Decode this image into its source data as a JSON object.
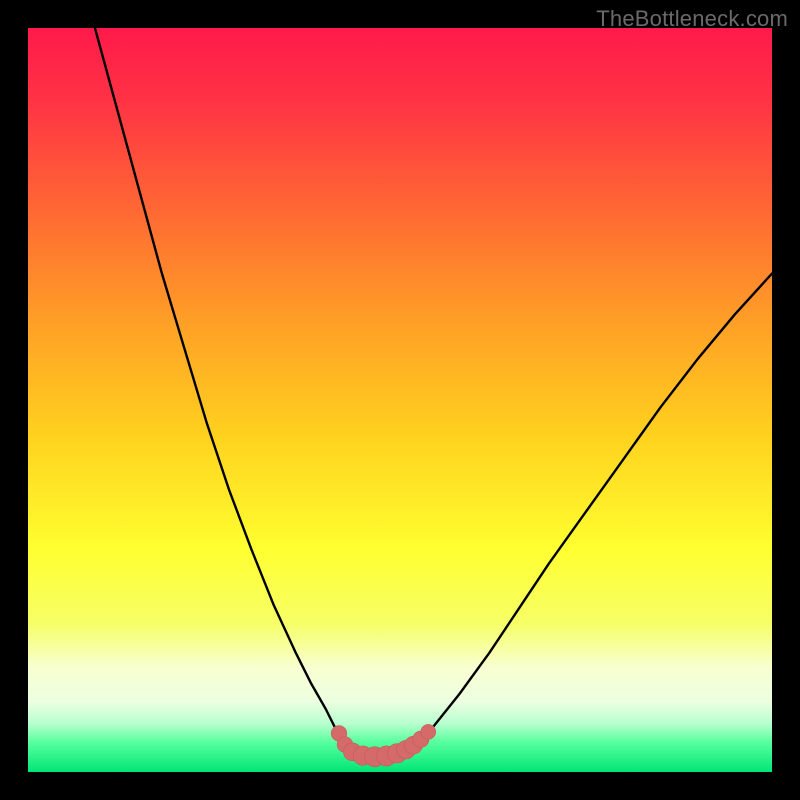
{
  "watermark": "TheBottleneck.com",
  "colors": {
    "black": "#000000",
    "curve": "#000000",
    "marker_fill": "#d46a6a",
    "marker_stroke": "#c85a5a",
    "gradient_stops": [
      {
        "offset": 0.0,
        "color": "#ff1a4b"
      },
      {
        "offset": 0.1,
        "color": "#ff3344"
      },
      {
        "offset": 0.25,
        "color": "#ff6a33"
      },
      {
        "offset": 0.4,
        "color": "#ffa126"
      },
      {
        "offset": 0.55,
        "color": "#ffd21e"
      },
      {
        "offset": 0.7,
        "color": "#ffff30"
      },
      {
        "offset": 0.8,
        "color": "#f6ff66"
      },
      {
        "offset": 0.86,
        "color": "#f8ffd2"
      },
      {
        "offset": 0.905,
        "color": "#ecffe0"
      },
      {
        "offset": 0.935,
        "color": "#b8ffcf"
      },
      {
        "offset": 0.96,
        "color": "#58ff9e"
      },
      {
        "offset": 1.0,
        "color": "#00e676"
      }
    ]
  },
  "chart_data": {
    "type": "line",
    "title": "",
    "xlabel": "",
    "ylabel": "",
    "xlim": [
      0,
      100
    ],
    "ylim": [
      0,
      100
    ],
    "grid": false,
    "legend": false,
    "series": [
      {
        "name": "left-branch",
        "x": [
          9,
          12,
          15,
          18,
          21,
          24,
          27,
          30,
          33,
          36,
          38,
          40,
          41.5,
          42.7
        ],
        "y": [
          100,
          89,
          78,
          67,
          57,
          47,
          38,
          30,
          22.5,
          16,
          12,
          8.5,
          5.5,
          3.2
        ]
      },
      {
        "name": "valley-floor",
        "x": [
          42.7,
          44,
          46,
          48,
          50,
          51.5
        ],
        "y": [
          3.2,
          2.4,
          2.1,
          2.1,
          2.4,
          3.0
        ]
      },
      {
        "name": "right-branch",
        "x": [
          51.5,
          54,
          58,
          62,
          66,
          70,
          75,
          80,
          85,
          90,
          95,
          100
        ],
        "y": [
          3.0,
          5.5,
          10.5,
          16,
          22,
          28,
          35,
          42,
          49,
          55.5,
          61.5,
          67
        ]
      }
    ],
    "markers": {
      "name": "valley-markers",
      "points": [
        {
          "x": 41.8,
          "y": 5.2,
          "r": 1.05
        },
        {
          "x": 42.6,
          "y": 3.7,
          "r": 1.05
        },
        {
          "x": 43.6,
          "y": 2.7,
          "r": 1.2
        },
        {
          "x": 45.0,
          "y": 2.2,
          "r": 1.3
        },
        {
          "x": 46.6,
          "y": 2.05,
          "r": 1.35
        },
        {
          "x": 48.2,
          "y": 2.15,
          "r": 1.35
        },
        {
          "x": 49.6,
          "y": 2.5,
          "r": 1.3
        },
        {
          "x": 50.8,
          "y": 3.0,
          "r": 1.25
        },
        {
          "x": 51.8,
          "y": 3.6,
          "r": 1.2
        },
        {
          "x": 52.8,
          "y": 4.4,
          "r": 1.1
        },
        {
          "x": 53.8,
          "y": 5.4,
          "r": 1.0
        }
      ]
    }
  }
}
